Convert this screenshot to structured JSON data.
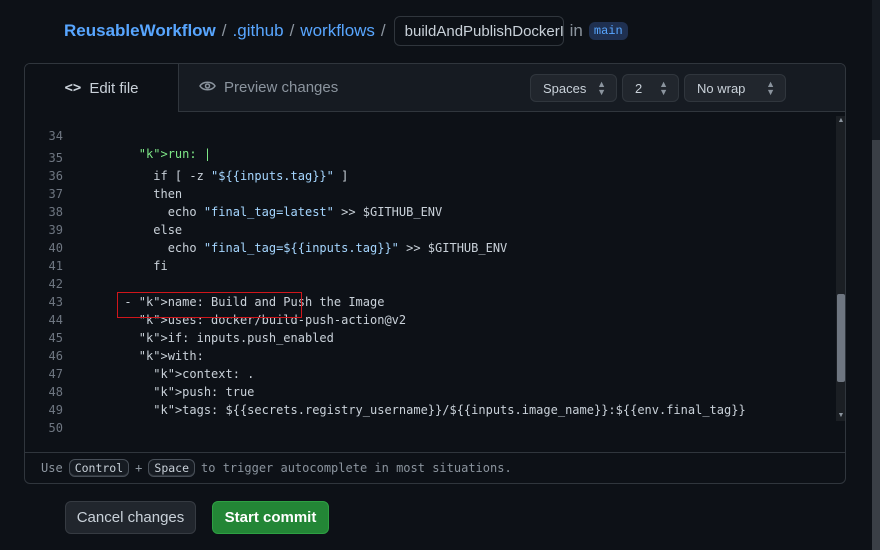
{
  "breadcrumb": {
    "repo": "ReusableWorkflow",
    "sep": "/",
    "path1": ".github",
    "path2": "workflows",
    "filename": "buildAndPublishDockerIm",
    "in_text": "in",
    "branch": "main"
  },
  "tabs": {
    "edit": {
      "icon": "<>",
      "label": "Edit file"
    },
    "preview": {
      "icon": "eye-icon",
      "label": "Preview changes"
    }
  },
  "controls": {
    "indent_mode": "Spaces",
    "indent_size": "2",
    "wrap_mode": "No wrap"
  },
  "code_lines": [
    {
      "num": "34",
      "text": "        run: |"
    },
    {
      "num": "35",
      "text": "          if [ -z \"${{inputs.tag}}\" ]"
    },
    {
      "num": "36",
      "text": "          then"
    },
    {
      "num": "37",
      "text": "            echo \"final_tag=latest\" >> $GITHUB_ENV"
    },
    {
      "num": "38",
      "text": "          else"
    },
    {
      "num": "39",
      "text": "            echo \"final_tag=${{inputs.tag}}\" >> $GITHUB_ENV"
    },
    {
      "num": "40",
      "text": "          fi"
    },
    {
      "num": "41",
      "text": ""
    },
    {
      "num": "42",
      "text": "      - name: Build and Push the Image"
    },
    {
      "num": "43",
      "text": "        uses: docker/build-push-action@v2"
    },
    {
      "num": "44",
      "text": "        if: inputs.push_enabled"
    },
    {
      "num": "45",
      "text": "        with:"
    },
    {
      "num": "46",
      "text": "          context: ."
    },
    {
      "num": "47",
      "text": "          push: true"
    },
    {
      "num": "48",
      "text": "          tags: ${{secrets.registry_username}}/${{inputs.image_name}}:${{env.final_tag}}"
    },
    {
      "num": "49",
      "text": ""
    },
    {
      "num": "50",
      "text": ""
    }
  ],
  "hint": {
    "prefix": "Use",
    "key1": "Control",
    "plus": "+",
    "key2": "Space",
    "suffix": "to trigger autocomplete in most situations."
  },
  "buttons": {
    "cancel": "Cancel changes",
    "commit": "Start commit"
  },
  "colors": {
    "background": "#0d1117",
    "link": "#58a6ff",
    "yaml_key": "#7ee787",
    "string": "#a5d6ff",
    "boolean": "#ff7b72",
    "highlight_box": "#d0161b",
    "commit_button": "#238636"
  }
}
